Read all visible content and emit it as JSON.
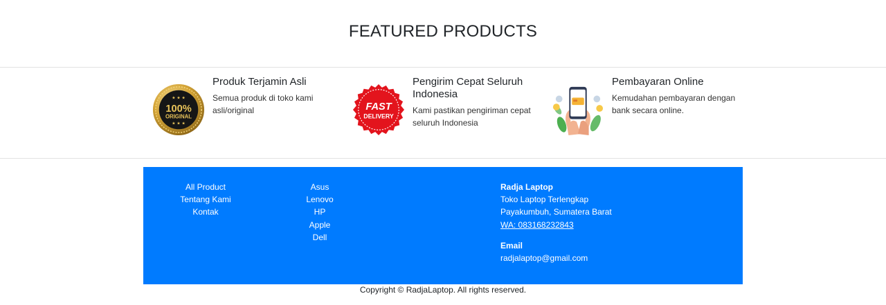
{
  "section": {
    "title": "FEATURED PRODUCTS"
  },
  "features": [
    {
      "title": "Produk Terjamin Asli",
      "desc": "Semua produk di toko kami asli/original",
      "badge_text_1": "100%",
      "badge_text_2": "ORIGINAL",
      "icon": "original-badge-icon"
    },
    {
      "title": "Pengirim Cepat Seluruh Indonesia",
      "desc": "Kami pastikan pengiriman cepat seluruh Indonesia",
      "badge_text_1": "FAST",
      "badge_text_2": "DELIVERY",
      "icon": "fast-delivery-icon"
    },
    {
      "title": "Pembayaran Online",
      "desc": "Kemudahan pembayaran dengan bank secara online.",
      "icon": "mobile-payment-icon"
    }
  ],
  "footer": {
    "links_col1": [
      "All Product",
      "Tentang Kami",
      "Kontak"
    ],
    "links_col2": [
      "Asus",
      "Lenovo",
      "HP",
      "Apple",
      "Dell"
    ],
    "company": {
      "name": "Radja Laptop",
      "tagline": "Toko Laptop Terlengkap",
      "address": "Payakumbuh, Sumatera Barat",
      "whatsapp": "WA: 083168232843"
    },
    "email_label": "Email",
    "email": "radjalaptop@gmail.com",
    "bg_color": "#007bff"
  },
  "copyright": "Copyright © RadjaLaptop. All rights reserved."
}
